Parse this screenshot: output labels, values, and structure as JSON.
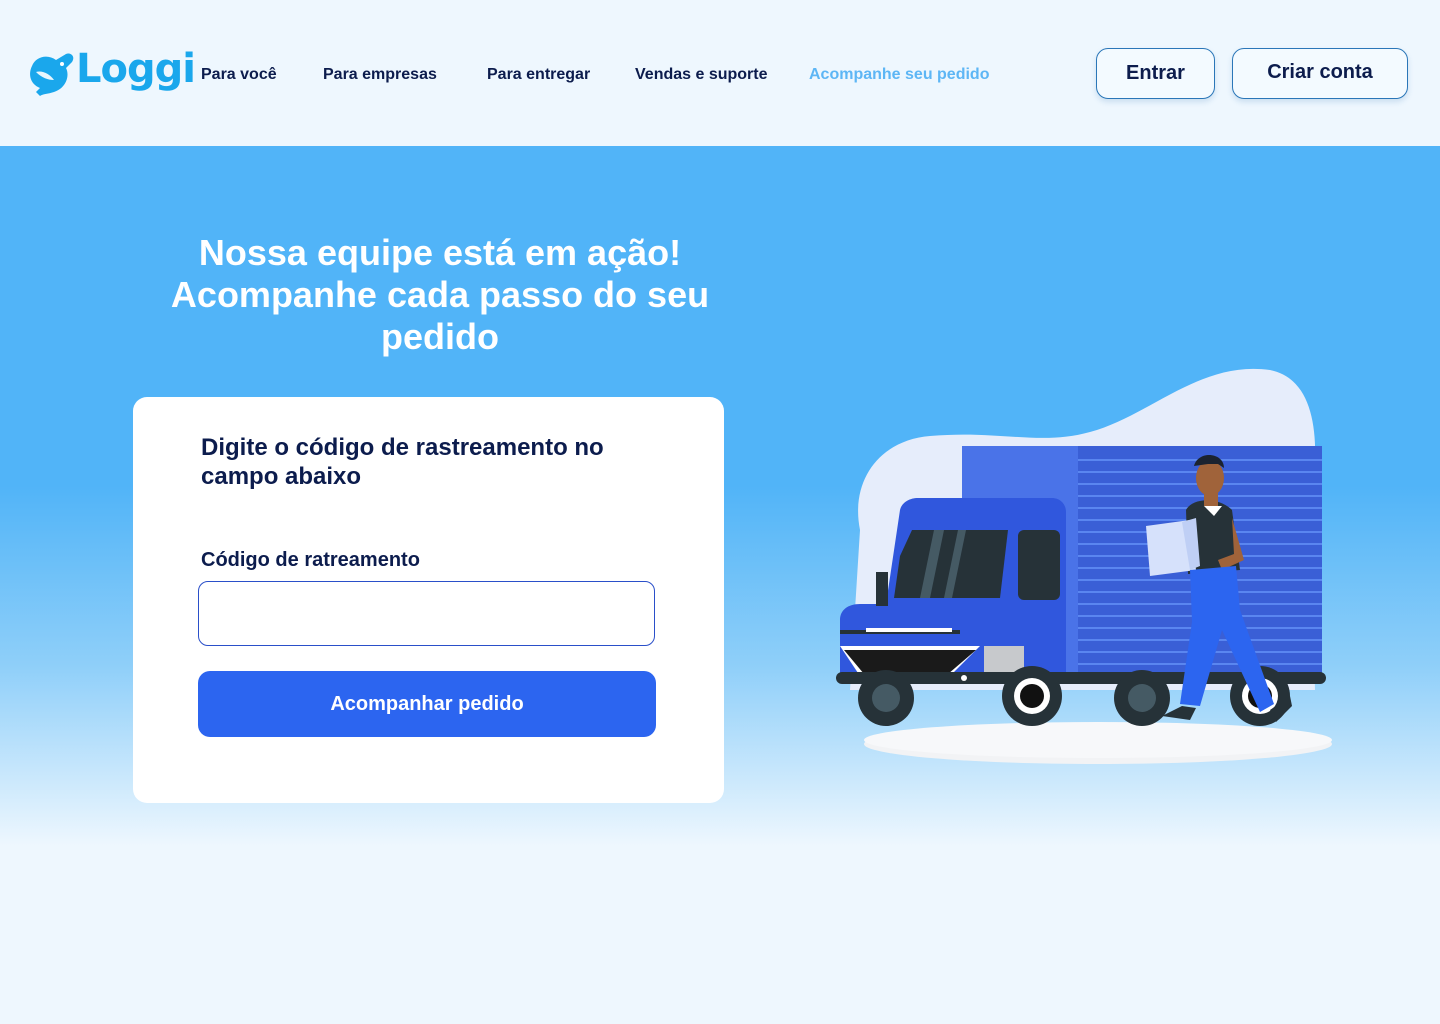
{
  "brand": {
    "name": "Loggi",
    "accent": "#1aa7ec"
  },
  "nav": {
    "items": [
      {
        "label": "Para você"
      },
      {
        "label": "Para empresas"
      },
      {
        "label": "Para entregar"
      },
      {
        "label": "Vendas e suporte"
      },
      {
        "label": "Acompanhe seu pedido",
        "active": true
      }
    ]
  },
  "auth": {
    "login_label": "Entrar",
    "signup_label": "Criar conta"
  },
  "hero": {
    "title_line1": "Nossa equipe está em ação!",
    "title_line2": "Acompanhe cada passo do seu",
    "title_line3": "pedido"
  },
  "tracking": {
    "title": "Digite o código de rastreamento no campo abaixo",
    "field_label": "Código de ratreamento",
    "input_value": "",
    "input_placeholder": "",
    "submit_label": "Acompanhar pedido"
  },
  "colors": {
    "hero_bg": "#51b4f8",
    "primary_button": "#2c65f0",
    "text_dark": "#0c1c4d",
    "nav_active": "#5db6f5"
  },
  "icons": {
    "logo": "loggi-rabbit-icon"
  }
}
